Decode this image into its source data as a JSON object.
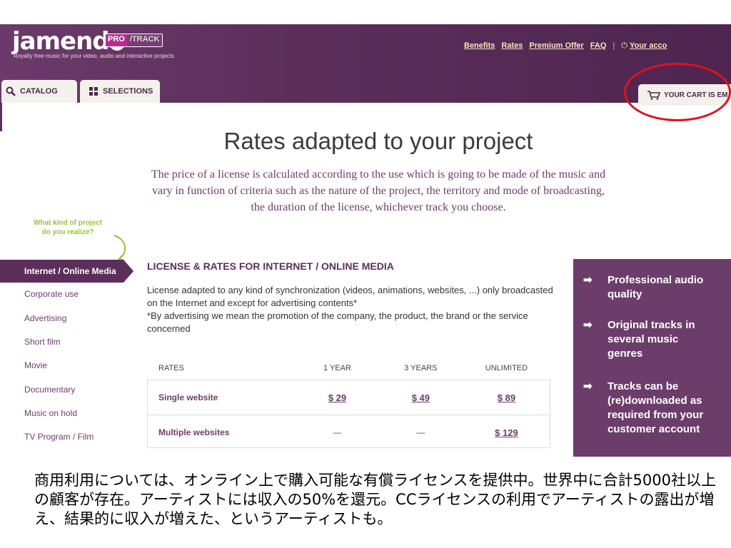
{
  "header": {
    "logo": "jamend",
    "badge_pro": "PRO",
    "badge_track": "/TRACK",
    "tagline": "Royalty free music for your video, audio and interactive projects",
    "nav": [
      "Benefits",
      "Rates",
      "Premium Offer",
      "FAQ"
    ],
    "account": "Your acco"
  },
  "tabs": {
    "catalog": "CATALOG",
    "selections": "SELECTIONS",
    "cart": "YOUR CART IS EM"
  },
  "main": {
    "title": "Rates adapted to your project",
    "intro": "The price of a license is calculated according to the use which is going to be made of the music and vary in function of criteria such as the nature of the project, the territory and mode of broadcasting, the duration of the license, whichever track you choose.",
    "callout_line1": "What kind of project",
    "callout_line2": "do you realize?"
  },
  "sidebar": {
    "active": "Internet / Online Media",
    "items": [
      "Corporate use",
      "Advertising",
      "Short film",
      "Movie",
      "Documentary",
      "Music on hold",
      "TV Program / Film"
    ]
  },
  "license": {
    "heading": "LICENSE & RATES FOR INTERNET / ONLINE MEDIA",
    "desc1": "License adapted to any kind of synchronization (videos, animations, websites, ...) only broadcasted on the Internet and except for advertising contents*",
    "desc2": "*By advertising we mean the promotion of the company, the product, the brand or the service concerned",
    "columns": [
      "RATES",
      "1 YEAR",
      "3 YEARS",
      "UNLIMITED"
    ],
    "rows": [
      {
        "label": "Single website",
        "y1": "$ 29",
        "y3": "$ 49",
        "unl": "$ 89"
      },
      {
        "label": "Multiple websites",
        "y1": "—",
        "y3": "—",
        "unl": "$ 129"
      }
    ]
  },
  "features": [
    "Professional audio quality",
    "Original tracks in several music genres",
    "Tracks can be (re)downloaded as required from your customer account"
  ],
  "caption": "商用利用については、オンライン上で購入可能な有償ライセンスを提供中。世界中に合計5000社以上の顧客が存在。アーティストには収入の50%を還元。CCライセンスの利用でアーティストの露出が増え、結果的に収入が増えた、というアーティストも。",
  "colors": {
    "brand": "#5c2f5b",
    "accent_green": "#9ac23c",
    "highlight_red": "#e0101c"
  }
}
